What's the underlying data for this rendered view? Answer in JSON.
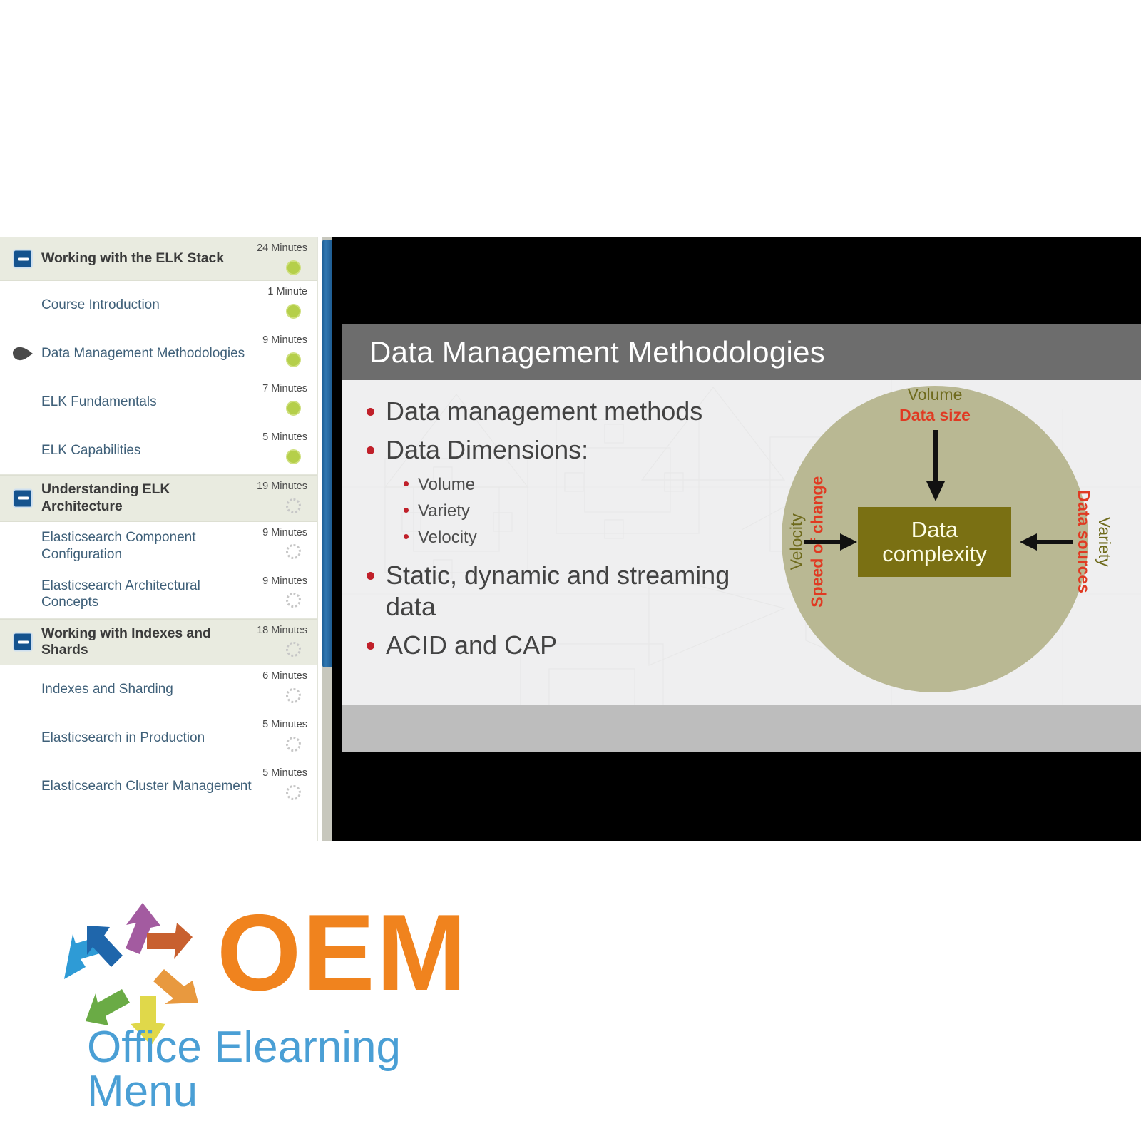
{
  "player": {
    "outline": {
      "sections": [
        {
          "type": "section",
          "label": "Working with the ELK Stack",
          "duration": "24 Minutes",
          "status": "done",
          "expanded": true,
          "toggle_icon": "minus-icon"
        },
        {
          "type": "lesson",
          "label": "Course Introduction",
          "duration": "1 Minute",
          "status": "done",
          "current": false
        },
        {
          "type": "lesson",
          "label": "Data Management Methodologies",
          "duration": "9 Minutes",
          "status": "done",
          "current": true
        },
        {
          "type": "lesson",
          "label": "ELK Fundamentals",
          "duration": "7 Minutes",
          "status": "done",
          "current": false
        },
        {
          "type": "lesson",
          "label": "ELK Capabilities",
          "duration": "5 Minutes",
          "status": "done",
          "current": false,
          "last": true
        },
        {
          "type": "section",
          "label": "Understanding ELK Architecture",
          "duration": "19 Minutes",
          "status": "todo",
          "expanded": true,
          "toggle_icon": "minus-icon"
        },
        {
          "type": "lesson",
          "label": "Elasticsearch Component Configuration",
          "duration": "9 Minutes",
          "status": "todo",
          "current": false
        },
        {
          "type": "lesson",
          "label": "Elasticsearch Architectural Concepts",
          "duration": "9 Minutes",
          "status": "todo",
          "current": false,
          "last": true
        },
        {
          "type": "section",
          "label": "Working with Indexes and Shards",
          "duration": "18 Minutes",
          "status": "todo",
          "expanded": true,
          "toggle_icon": "minus-icon"
        },
        {
          "type": "lesson",
          "label": "Indexes and Sharding",
          "duration": "6 Minutes",
          "status": "todo",
          "current": false
        },
        {
          "type": "lesson",
          "label": "Elasticsearch in Production",
          "duration": "5 Minutes",
          "status": "todo",
          "current": false
        },
        {
          "type": "lesson",
          "label": "Elasticsearch Cluster Management",
          "duration": "5 Minutes",
          "status": "todo",
          "current": false
        }
      ]
    },
    "scrollbar": {
      "name": "outline-scrollbar",
      "thumb_color": "#2f76b0"
    }
  },
  "slide": {
    "title": "Data Management Methodologies",
    "bullets": [
      {
        "level": 1,
        "text": "Data management methods"
      },
      {
        "level": 1,
        "text": "Data Dimensions:"
      },
      {
        "level": 2,
        "text": "Volume"
      },
      {
        "level": 2,
        "text": "Variety"
      },
      {
        "level": 2,
        "text": "Velocity"
      },
      {
        "level": 1,
        "text": "Static, dynamic and streaming data"
      },
      {
        "level": 1,
        "text": "ACID and CAP"
      }
    ],
    "diagram": {
      "center_line1": "Data",
      "center_line2": "complexity",
      "top": {
        "title": "Volume",
        "subtitle": "Data size"
      },
      "left": {
        "title": "Velocity",
        "subtitle": "Speed of change"
      },
      "right": {
        "title": "Variety",
        "subtitle": "Data sources"
      },
      "circle_color": "#b9b893",
      "center_box_color": "#7a7013",
      "title_color": "#6e6a1c",
      "subtitle_color": "#e03a22"
    }
  },
  "logo": {
    "wordmark": "OEM",
    "tagline": "Office Elearning Menu",
    "wordmark_color": "#f0831e",
    "tagline_color": "#4a9fd5",
    "arrow_colors": [
      "#1f66ab",
      "#a35ba0",
      "#c8602f",
      "#2e9bd6",
      "#e8993f",
      "#6aab45",
      "#e0d84a"
    ]
  }
}
